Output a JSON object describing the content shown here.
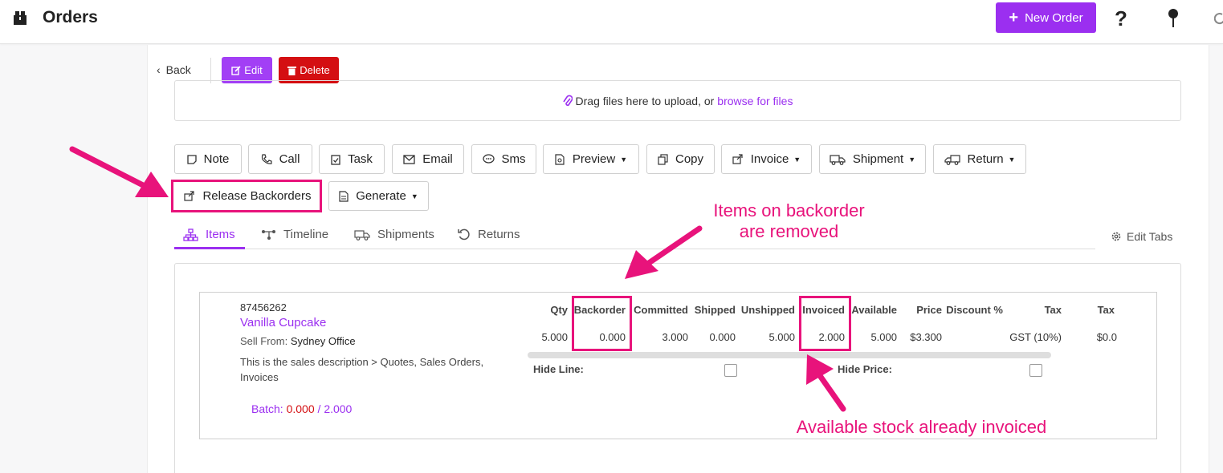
{
  "header": {
    "title": "Orders",
    "new_order_label": "New Order",
    "help_symbol": "?"
  },
  "actions": {
    "back": "Back",
    "edit": "Edit",
    "delete": "Delete"
  },
  "upload": {
    "prompt": "Drag files here to upload, or",
    "link": "browse for files"
  },
  "toolbar": [
    {
      "label": "Note"
    },
    {
      "label": "Call"
    },
    {
      "label": "Task"
    },
    {
      "label": "Email"
    },
    {
      "label": "Sms"
    },
    {
      "label": "Preview",
      "dropdown": true
    },
    {
      "label": "Copy"
    },
    {
      "label": "Invoice",
      "dropdown": true
    },
    {
      "label": "Shipment",
      "dropdown": true
    },
    {
      "label": "Return",
      "dropdown": true
    },
    {
      "label": "Release Backorders"
    },
    {
      "label": "Generate",
      "dropdown": true
    }
  ],
  "tabs": [
    {
      "label": "Items",
      "active": true
    },
    {
      "label": "Timeline"
    },
    {
      "label": "Shipments"
    },
    {
      "label": "Returns"
    }
  ],
  "edit_tabs": "Edit Tabs",
  "item": {
    "sku": "87456262",
    "name": "Vanilla Cupcake",
    "sell_from_label": "Sell From:",
    "sell_from_value": "Sydney Office",
    "description": "This is the sales description > Quotes, Sales Orders, Invoices",
    "batch_label": "Batch:",
    "batch_used": "0.000",
    "batch_sep": "/",
    "batch_total": "2.000",
    "hide_line_label": "Hide Line:",
    "hide_price_label": "Hide Price:",
    "columns": [
      "Qty",
      "Backorder",
      "Committed",
      "Shipped",
      "Unshipped",
      "Invoiced",
      "Available",
      "Price",
      "Discount %",
      "Tax",
      "Tax"
    ],
    "values": [
      "5.000",
      "0.000",
      "3.000",
      "0.000",
      "5.000",
      "2.000",
      "5.000",
      "$3.300",
      "",
      "GST (10%)",
      "$0.0"
    ]
  },
  "annotations": {
    "backorder_note_line1": "Items on backorder",
    "backorder_note_line2": "are removed",
    "invoiced_note": "Available stock already invoiced",
    "color": "#e8137b"
  },
  "colors": {
    "accent": "#9b2ff0",
    "danger": "#d40f12"
  }
}
